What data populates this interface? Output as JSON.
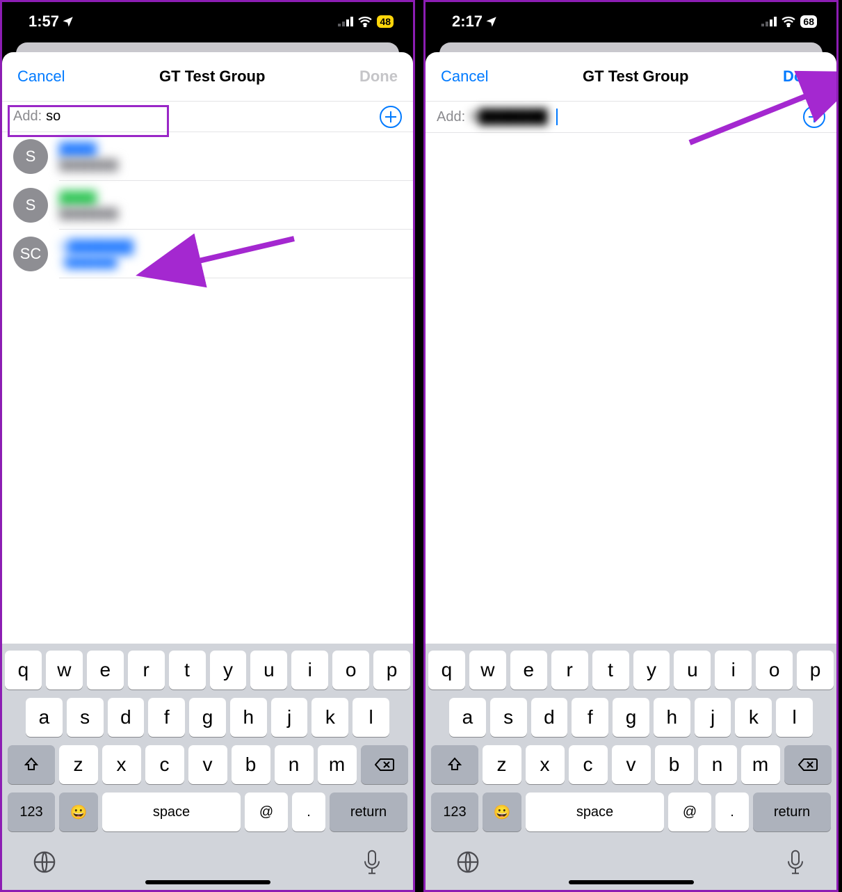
{
  "left": {
    "status": {
      "time": "1:57",
      "battery": "48"
    },
    "nav": {
      "cancel": "Cancel",
      "title": "GT Test Group",
      "done": "Done"
    },
    "add": {
      "label": "Add:",
      "value": "so"
    },
    "contacts": [
      {
        "avatar": "S",
        "name": "████",
        "sub": "████████",
        "colorClass": "blur-blue"
      },
      {
        "avatar": "S",
        "name": "████",
        "sub": "████████",
        "colorClass": "blur-green"
      },
      {
        "avatar": "SC",
        "name": "S███████",
        "sub": "+███████",
        "colorClass": "blur-blue"
      }
    ]
  },
  "right": {
    "status": {
      "time": "2:17",
      "battery": "68"
    },
    "nav": {
      "cancel": "Cancel",
      "title": "GT Test Group",
      "done": "Done"
    },
    "add": {
      "label": "Add:",
      "value": "S███████"
    }
  },
  "keyboard": {
    "row1": [
      "q",
      "w",
      "e",
      "r",
      "t",
      "y",
      "u",
      "i",
      "o",
      "p"
    ],
    "row2": [
      "a",
      "s",
      "d",
      "f",
      "g",
      "h",
      "j",
      "k",
      "l"
    ],
    "row3": [
      "z",
      "x",
      "c",
      "v",
      "b",
      "n",
      "m"
    ],
    "numKey": "123",
    "space": "space",
    "at": "@",
    "dot": ".",
    "ret": "return"
  }
}
